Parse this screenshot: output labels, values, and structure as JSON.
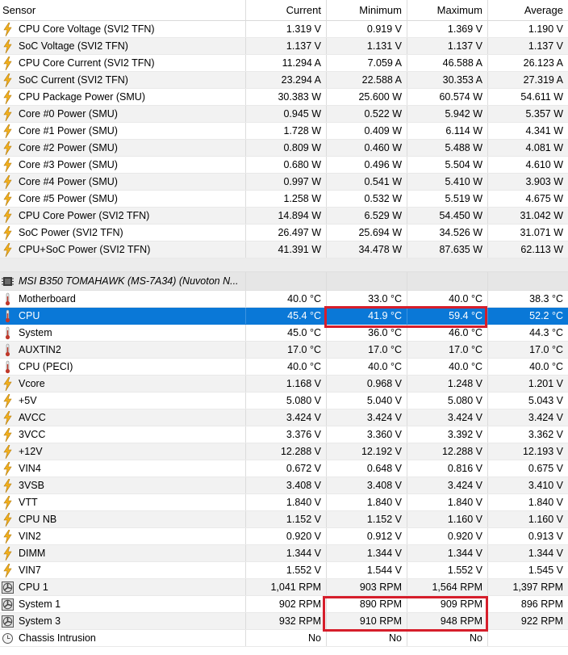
{
  "columns": [
    "Sensor",
    "Current",
    "Minimum",
    "Maximum",
    "Average"
  ],
  "cpu_rows": [
    {
      "icon": "lightning-icon",
      "name": "CPU Core Voltage (SVI2 TFN)",
      "current": "1.319 V",
      "min": "0.919 V",
      "max": "1.369 V",
      "avg": "1.190 V"
    },
    {
      "icon": "lightning-icon",
      "name": "SoC Voltage (SVI2 TFN)",
      "current": "1.137 V",
      "min": "1.131 V",
      "max": "1.137 V",
      "avg": "1.137 V"
    },
    {
      "icon": "lightning-icon",
      "name": "CPU Core Current (SVI2 TFN)",
      "current": "11.294 A",
      "min": "7.059 A",
      "max": "46.588 A",
      "avg": "26.123 A"
    },
    {
      "icon": "lightning-icon",
      "name": "SoC Current (SVI2 TFN)",
      "current": "23.294 A",
      "min": "22.588 A",
      "max": "30.353 A",
      "avg": "27.319 A"
    },
    {
      "icon": "lightning-icon",
      "name": "CPU Package Power (SMU)",
      "current": "30.383 W",
      "min": "25.600 W",
      "max": "60.574 W",
      "avg": "54.611 W"
    },
    {
      "icon": "lightning-icon",
      "name": "Core #0 Power (SMU)",
      "current": "0.945 W",
      "min": "0.522 W",
      "max": "5.942 W",
      "avg": "5.357 W"
    },
    {
      "icon": "lightning-icon",
      "name": "Core #1 Power (SMU)",
      "current": "1.728 W",
      "min": "0.409 W",
      "max": "6.114 W",
      "avg": "4.341 W"
    },
    {
      "icon": "lightning-icon",
      "name": "Core #2 Power (SMU)",
      "current": "0.809 W",
      "min": "0.460 W",
      "max": "5.488 W",
      "avg": "4.081 W"
    },
    {
      "icon": "lightning-icon",
      "name": "Core #3 Power (SMU)",
      "current": "0.680 W",
      "min": "0.496 W",
      "max": "5.504 W",
      "avg": "4.610 W"
    },
    {
      "icon": "lightning-icon",
      "name": "Core #4 Power (SMU)",
      "current": "0.997 W",
      "min": "0.541 W",
      "max": "5.410 W",
      "avg": "3.903 W"
    },
    {
      "icon": "lightning-icon",
      "name": "Core #5 Power (SMU)",
      "current": "1.258 W",
      "min": "0.532 W",
      "max": "5.519 W",
      "avg": "4.675 W"
    },
    {
      "icon": "lightning-icon",
      "name": "CPU Core Power (SVI2 TFN)",
      "current": "14.894 W",
      "min": "6.529 W",
      "max": "54.450 W",
      "avg": "31.042 W"
    },
    {
      "icon": "lightning-icon",
      "name": "SoC Power (SVI2 TFN)",
      "current": "26.497 W",
      "min": "25.694 W",
      "max": "34.526 W",
      "avg": "31.071 W"
    },
    {
      "icon": "lightning-icon",
      "name": "CPU+SoC Power (SVI2 TFN)",
      "current": "41.391 W",
      "min": "34.478 W",
      "max": "87.635 W",
      "avg": "62.113 W"
    }
  ],
  "group": {
    "icon": "chip-icon",
    "name": "MSI B350 TOMAHAWK (MS-7A34) (Nuvoton N..."
  },
  "board_rows": [
    {
      "icon": "thermometer-icon",
      "name": "Motherboard",
      "current": "40.0 °C",
      "min": "33.0 °C",
      "max": "40.0 °C",
      "avg": "38.3 °C"
    },
    {
      "icon": "thermometer-icon",
      "name": "CPU",
      "current": "45.4 °C",
      "min": "41.9 °C",
      "max": "59.4 °C",
      "avg": "52.2 °C",
      "selected": true
    },
    {
      "icon": "thermometer-icon",
      "name": "System",
      "current": "45.0 °C",
      "min": "36.0 °C",
      "max": "46.0 °C",
      "avg": "44.3 °C"
    },
    {
      "icon": "thermometer-icon",
      "name": "AUXTIN2",
      "current": "17.0 °C",
      "min": "17.0 °C",
      "max": "17.0 °C",
      "avg": "17.0 °C"
    },
    {
      "icon": "thermometer-icon",
      "name": "CPU (PECI)",
      "current": "40.0 °C",
      "min": "40.0 °C",
      "max": "40.0 °C",
      "avg": "40.0 °C"
    },
    {
      "icon": "lightning-icon",
      "name": "Vcore",
      "current": "1.168 V",
      "min": "0.968 V",
      "max": "1.248 V",
      "avg": "1.201 V"
    },
    {
      "icon": "lightning-icon",
      "name": "+5V",
      "current": "5.080 V",
      "min": "5.040 V",
      "max": "5.080 V",
      "avg": "5.043 V"
    },
    {
      "icon": "lightning-icon",
      "name": "AVCC",
      "current": "3.424 V",
      "min": "3.424 V",
      "max": "3.424 V",
      "avg": "3.424 V"
    },
    {
      "icon": "lightning-icon",
      "name": "3VCC",
      "current": "3.376 V",
      "min": "3.360 V",
      "max": "3.392 V",
      "avg": "3.362 V"
    },
    {
      "icon": "lightning-icon",
      "name": "+12V",
      "current": "12.288 V",
      "min": "12.192 V",
      "max": "12.288 V",
      "avg": "12.193 V"
    },
    {
      "icon": "lightning-icon",
      "name": "VIN4",
      "current": "0.672 V",
      "min": "0.648 V",
      "max": "0.816 V",
      "avg": "0.675 V"
    },
    {
      "icon": "lightning-icon",
      "name": "3VSB",
      "current": "3.408 V",
      "min": "3.408 V",
      "max": "3.424 V",
      "avg": "3.410 V"
    },
    {
      "icon": "lightning-icon",
      "name": "VTT",
      "current": "1.840 V",
      "min": "1.840 V",
      "max": "1.840 V",
      "avg": "1.840 V"
    },
    {
      "icon": "lightning-icon",
      "name": "CPU NB",
      "current": "1.152 V",
      "min": "1.152 V",
      "max": "1.160 V",
      "avg": "1.160 V"
    },
    {
      "icon": "lightning-icon",
      "name": "VIN2",
      "current": "0.920 V",
      "min": "0.912 V",
      "max": "0.920 V",
      "avg": "0.913 V"
    },
    {
      "icon": "lightning-icon",
      "name": "DIMM",
      "current": "1.344 V",
      "min": "1.344 V",
      "max": "1.344 V",
      "avg": "1.344 V"
    },
    {
      "icon": "lightning-icon",
      "name": "VIN7",
      "current": "1.552 V",
      "min": "1.544 V",
      "max": "1.552 V",
      "avg": "1.545 V"
    },
    {
      "icon": "fan-icon",
      "name": "CPU 1",
      "current": "1,041 RPM",
      "min": "903 RPM",
      "max": "1,564 RPM",
      "avg": "1,397 RPM"
    },
    {
      "icon": "fan-icon",
      "name": "System 1",
      "current": "902 RPM",
      "min": "890 RPM",
      "max": "909 RPM",
      "avg": "896 RPM"
    },
    {
      "icon": "fan-icon",
      "name": "System 3",
      "current": "932 RPM",
      "min": "910 RPM",
      "max": "948 RPM",
      "avg": "922 RPM"
    },
    {
      "icon": "clock-icon",
      "name": "Chassis Intrusion",
      "current": "No",
      "min": "No",
      "max": "No",
      "avg": ""
    }
  ],
  "colors": {
    "selection": "#0a78d7",
    "highlight_box": "#d61e2b",
    "lightning": "#f2b01e",
    "thermometer": "#c0392b"
  }
}
